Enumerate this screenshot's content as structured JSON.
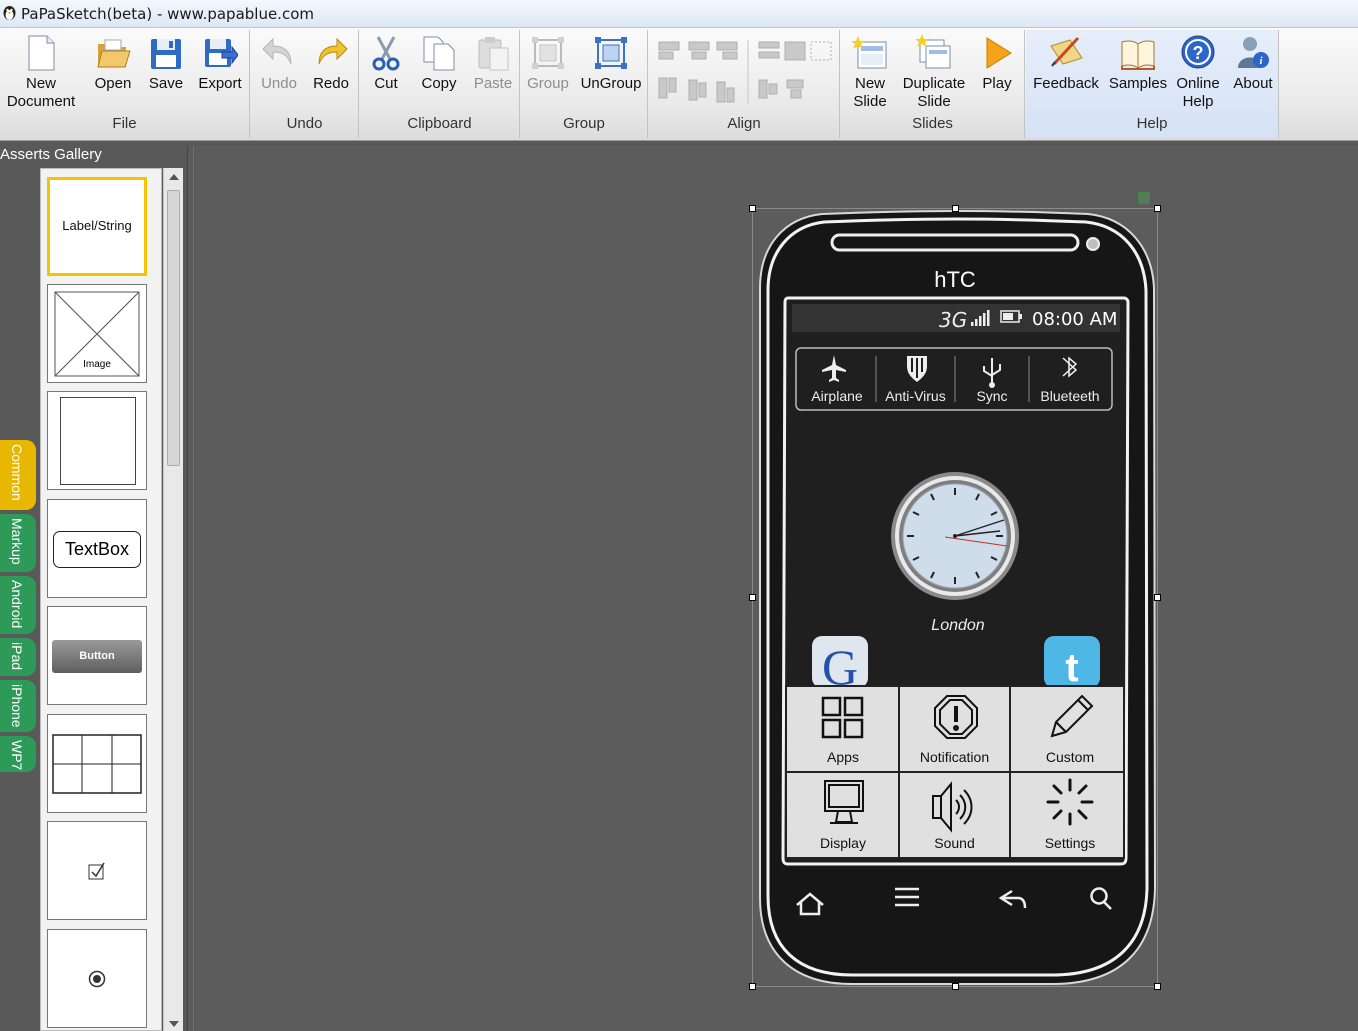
{
  "window": {
    "title": "PaPaSketch(beta) - www.papablue.com"
  },
  "ribbon": {
    "file": {
      "label": "File",
      "new_doc": "New\nDocument",
      "open": "Open",
      "save": "Save",
      "export": "Export"
    },
    "undo": {
      "label": "Undo",
      "undo": "Undo",
      "redo": "Redo"
    },
    "clipboard": {
      "label": "Clipboard",
      "cut": "Cut",
      "copy": "Copy",
      "paste": "Paste"
    },
    "group": {
      "label": "Group",
      "group": "Group",
      "ungroup": "UnGroup"
    },
    "align": {
      "label": "Align"
    },
    "slides": {
      "label": "Slides",
      "new_slide": "New\nSlide",
      "duplicate_slide": "Duplicate\nSlide",
      "play": "Play"
    },
    "help": {
      "label": "Help",
      "feedback": "Feedback",
      "samples": "Samples",
      "online_help": "Online\nHelp",
      "about": "About"
    }
  },
  "gallery": {
    "header": "Asserts Gallery",
    "tabs": [
      "Common",
      "Markup",
      "Android",
      "iPad",
      "iPhone",
      "WP7"
    ],
    "items": {
      "label": "Label/String",
      "image": "Image",
      "textbox": "TextBox",
      "button": "Button"
    }
  },
  "phone": {
    "brand": "hTC",
    "network": "3G",
    "time": "08:00 AM",
    "toggles": [
      "Airplane",
      "Anti-Virus",
      "Sync",
      "Blueteeth"
    ],
    "clock_city": "London",
    "menu": [
      "Apps",
      "Notification",
      "Custom",
      "Display",
      "Sound",
      "Settings"
    ]
  },
  "colors": {
    "common_tab": "#e8b700",
    "platform_tab": "#2e9a58",
    "selection": "#f4c400"
  }
}
